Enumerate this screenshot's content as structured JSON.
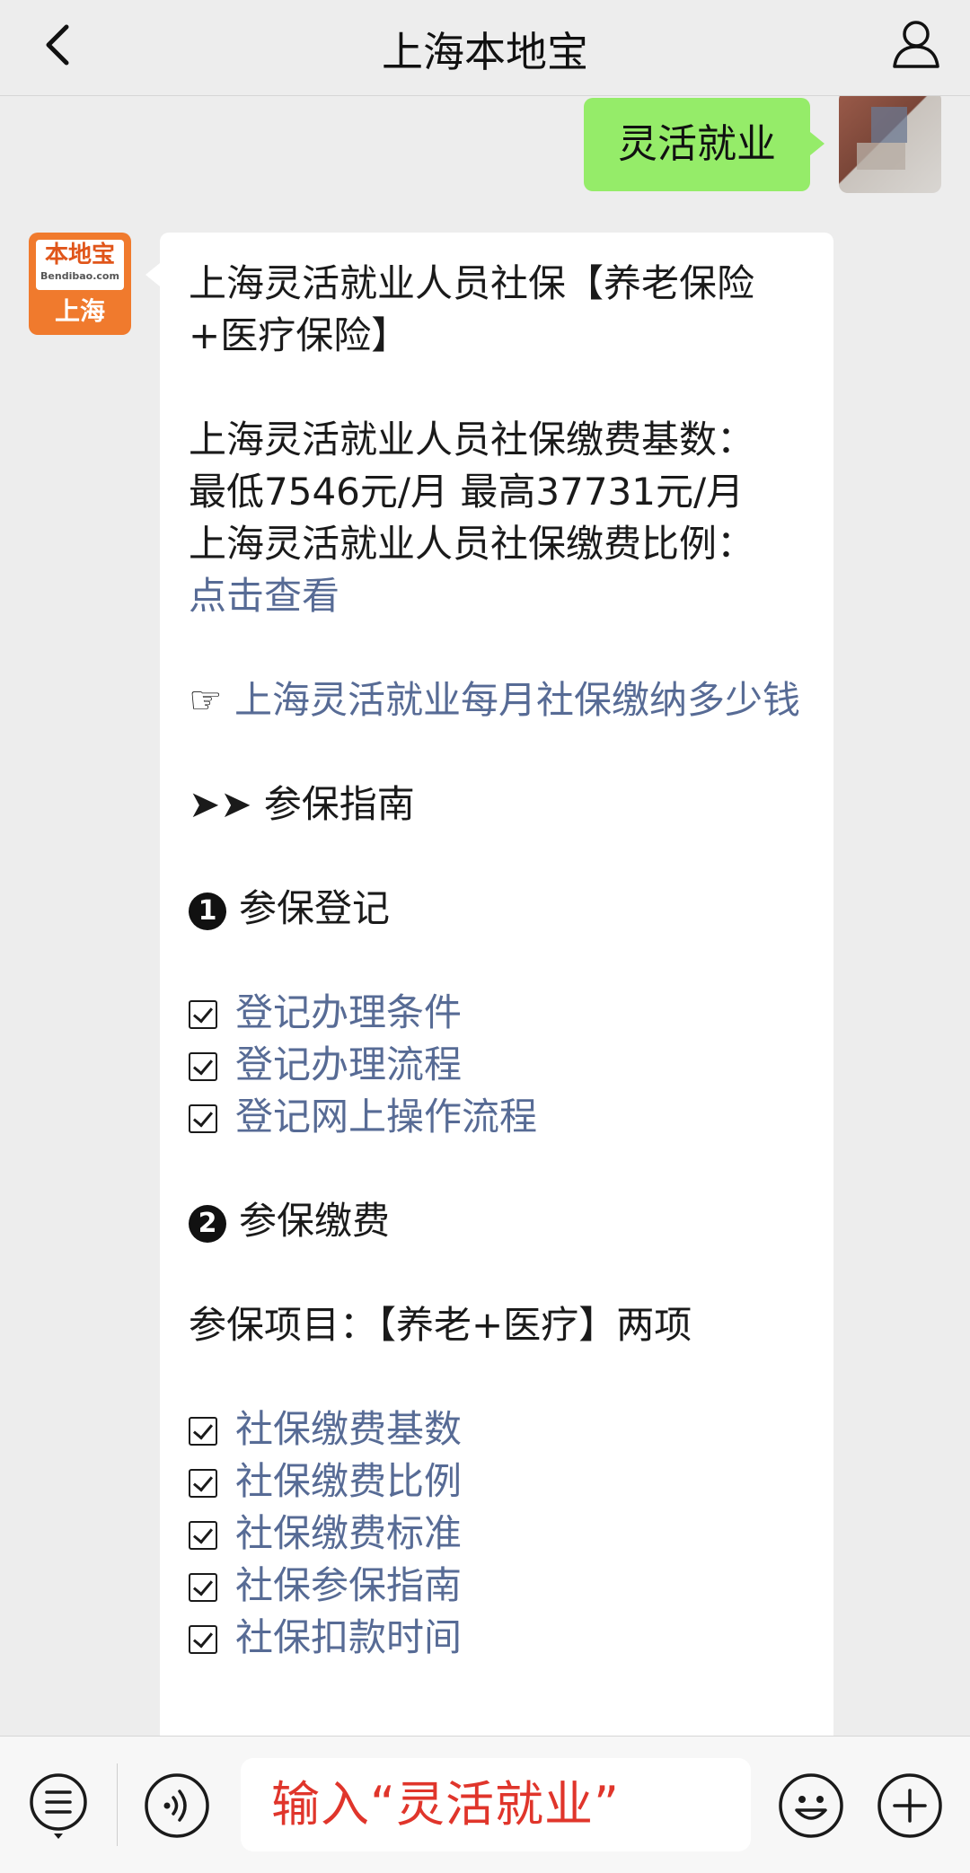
{
  "header": {
    "title": "上海本地宝",
    "back_icon": "chevron-left-icon",
    "profile_icon": "person-icon"
  },
  "messages": {
    "sent": {
      "text": "灵活就业"
    },
    "bot_avatar": {
      "brand": "本地宝",
      "site": "Bendibao.com",
      "city": "上海"
    },
    "reply": {
      "title": "上海灵活就业人员社保【养老保险+医疗保险】",
      "base_line1": "上海灵活就业人员社保缴费基数：",
      "base_line2": "最低7546元/月 最高37731元/月",
      "ratio_label": "上海灵活就业人员社保缴费比例：",
      "ratio_link": "点击查看",
      "monthly_pointer": "☞",
      "monthly_link": "上海灵活就业每月社保缴纳多少钱",
      "guide_prefix": "➤➤",
      "guide_title": "参保指南",
      "section1_num": "1",
      "section1_title": "参保登记",
      "section1_items": [
        "登记办理条件",
        "登记办理流程",
        "登记网上操作流程"
      ],
      "section2_num": "2",
      "section2_title": "参保缴费",
      "items_line": "参保项目：【养老+医疗】两项",
      "section2_items": [
        "社保缴费基数",
        "社保缴费比例",
        "社保缴费标准",
        "社保参保指南",
        "社保扣款时间"
      ]
    }
  },
  "input_bar": {
    "input_text": "输入“灵活就业”",
    "menu_icon": "menu-list-icon",
    "voice_icon": "voice-icon",
    "emoji_icon": "emoji-icon",
    "plus_icon": "plus-icon"
  },
  "colors": {
    "sent_bubble": "#95ec69",
    "link": "#576b95",
    "input_text": "#e0352b",
    "brand": "#f07a2d"
  }
}
